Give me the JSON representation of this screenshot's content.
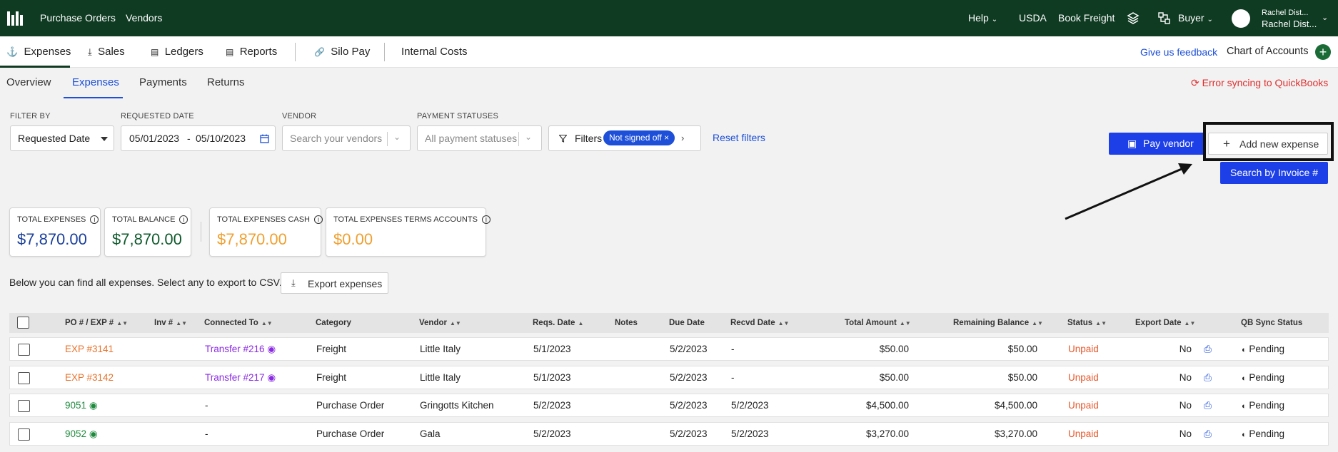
{
  "topnav": {
    "purchase_orders": "Purchase Orders",
    "vendors": "Vendors",
    "help": "Help",
    "usda": "USDA",
    "book_freight": "Book Freight",
    "buyer": "Buyer",
    "user_line1": "Rachel Dist...",
    "user_line2": "Rachel Dist..."
  },
  "secnav": {
    "expenses": "Expenses",
    "sales": "Sales",
    "ledgers": "Ledgers",
    "reports": "Reports",
    "silo_pay": "Silo Pay",
    "internal_costs": "Internal Costs",
    "feedback": "Give us feedback",
    "chart_of_accounts": "Chart of Accounts"
  },
  "subtabs": [
    "Overview",
    "Expenses",
    "Payments",
    "Returns"
  ],
  "sync_error": "Error syncing to QuickBooks",
  "filters": {
    "filter_by_label": "FILTER BY",
    "filter_by_value": "Requested Date",
    "requested_date_label": "REQUESTED DATE",
    "date_from": "05/01/2023",
    "date_sep": "-",
    "date_to": "05/10/2023",
    "vendor_label": "VENDOR",
    "vendor_placeholder": "Search your vendors",
    "payment_label": "PAYMENT STATUSES",
    "payment_placeholder": "All payment statuses",
    "filters_button": "Filters",
    "active_pill": "Not signed off",
    "reset": "Reset filters"
  },
  "actions": {
    "pay_vendor": "Pay vendor",
    "add_new_expense": "Add new expense",
    "search_by_invoice": "Search by Invoice #"
  },
  "totals": [
    {
      "label": "TOTAL EXPENSES",
      "value": "$7,870.00",
      "color": "#1a3f9c"
    },
    {
      "label": "TOTAL BALANCE",
      "value": "$7,870.00",
      "color": "#0f5a2c"
    },
    {
      "label": "TOTAL EXPENSES CASH",
      "value": "$7,870.00",
      "color": "#f0a030"
    },
    {
      "label": "TOTAL EXPENSES TERMS ACCOUNTS",
      "value": "$0.00",
      "color": "#f0a030"
    }
  ],
  "below_text": "Below you can find all expenses. Select any to export to CSV.",
  "export_label": "Export expenses",
  "table": {
    "headers": [
      "PO # / EXP #",
      "Inv #",
      "Connected To",
      "Category",
      "Vendor",
      "Reqs. Date",
      "Notes",
      "Due Date",
      "Recvd Date",
      "Total Amount",
      "Remaining Balance",
      "Status",
      "Export Date",
      "QB Sync Status"
    ],
    "rows": [
      {
        "po": "EXP #3141",
        "inv": "",
        "connected": "Transfer #216",
        "category": "Freight",
        "vendor": "Little Italy",
        "reqs": "5/1/2023",
        "notes": "",
        "due": "5/2/2023",
        "recvd": "-",
        "total": "$50.00",
        "remaining": "$50.00",
        "status": "Unpaid",
        "export": "No",
        "sync": "Pending"
      },
      {
        "po": "EXP #3142",
        "inv": "",
        "connected": "Transfer #217",
        "category": "Freight",
        "vendor": "Little Italy",
        "reqs": "5/1/2023",
        "notes": "",
        "due": "5/2/2023",
        "recvd": "-",
        "total": "$50.00",
        "remaining": "$50.00",
        "status": "Unpaid",
        "export": "No",
        "sync": "Pending"
      },
      {
        "po": "9051",
        "inv": "",
        "connected": "-",
        "category": "Purchase Order",
        "vendor": "Gringotts Kitchen",
        "reqs": "5/2/2023",
        "notes": "",
        "due": "5/2/2023",
        "recvd": "5/2/2023",
        "total": "$4,500.00",
        "remaining": "$4,500.00",
        "status": "Unpaid",
        "export": "No",
        "sync": "Pending"
      },
      {
        "po": "9052",
        "inv": "",
        "connected": "-",
        "category": "Purchase Order",
        "vendor": "Gala",
        "reqs": "5/2/2023",
        "notes": "",
        "due": "5/2/2023",
        "recvd": "5/2/2023",
        "total": "$3,270.00",
        "remaining": "$3,270.00",
        "status": "Unpaid",
        "export": "No",
        "sync": "Pending"
      }
    ]
  }
}
